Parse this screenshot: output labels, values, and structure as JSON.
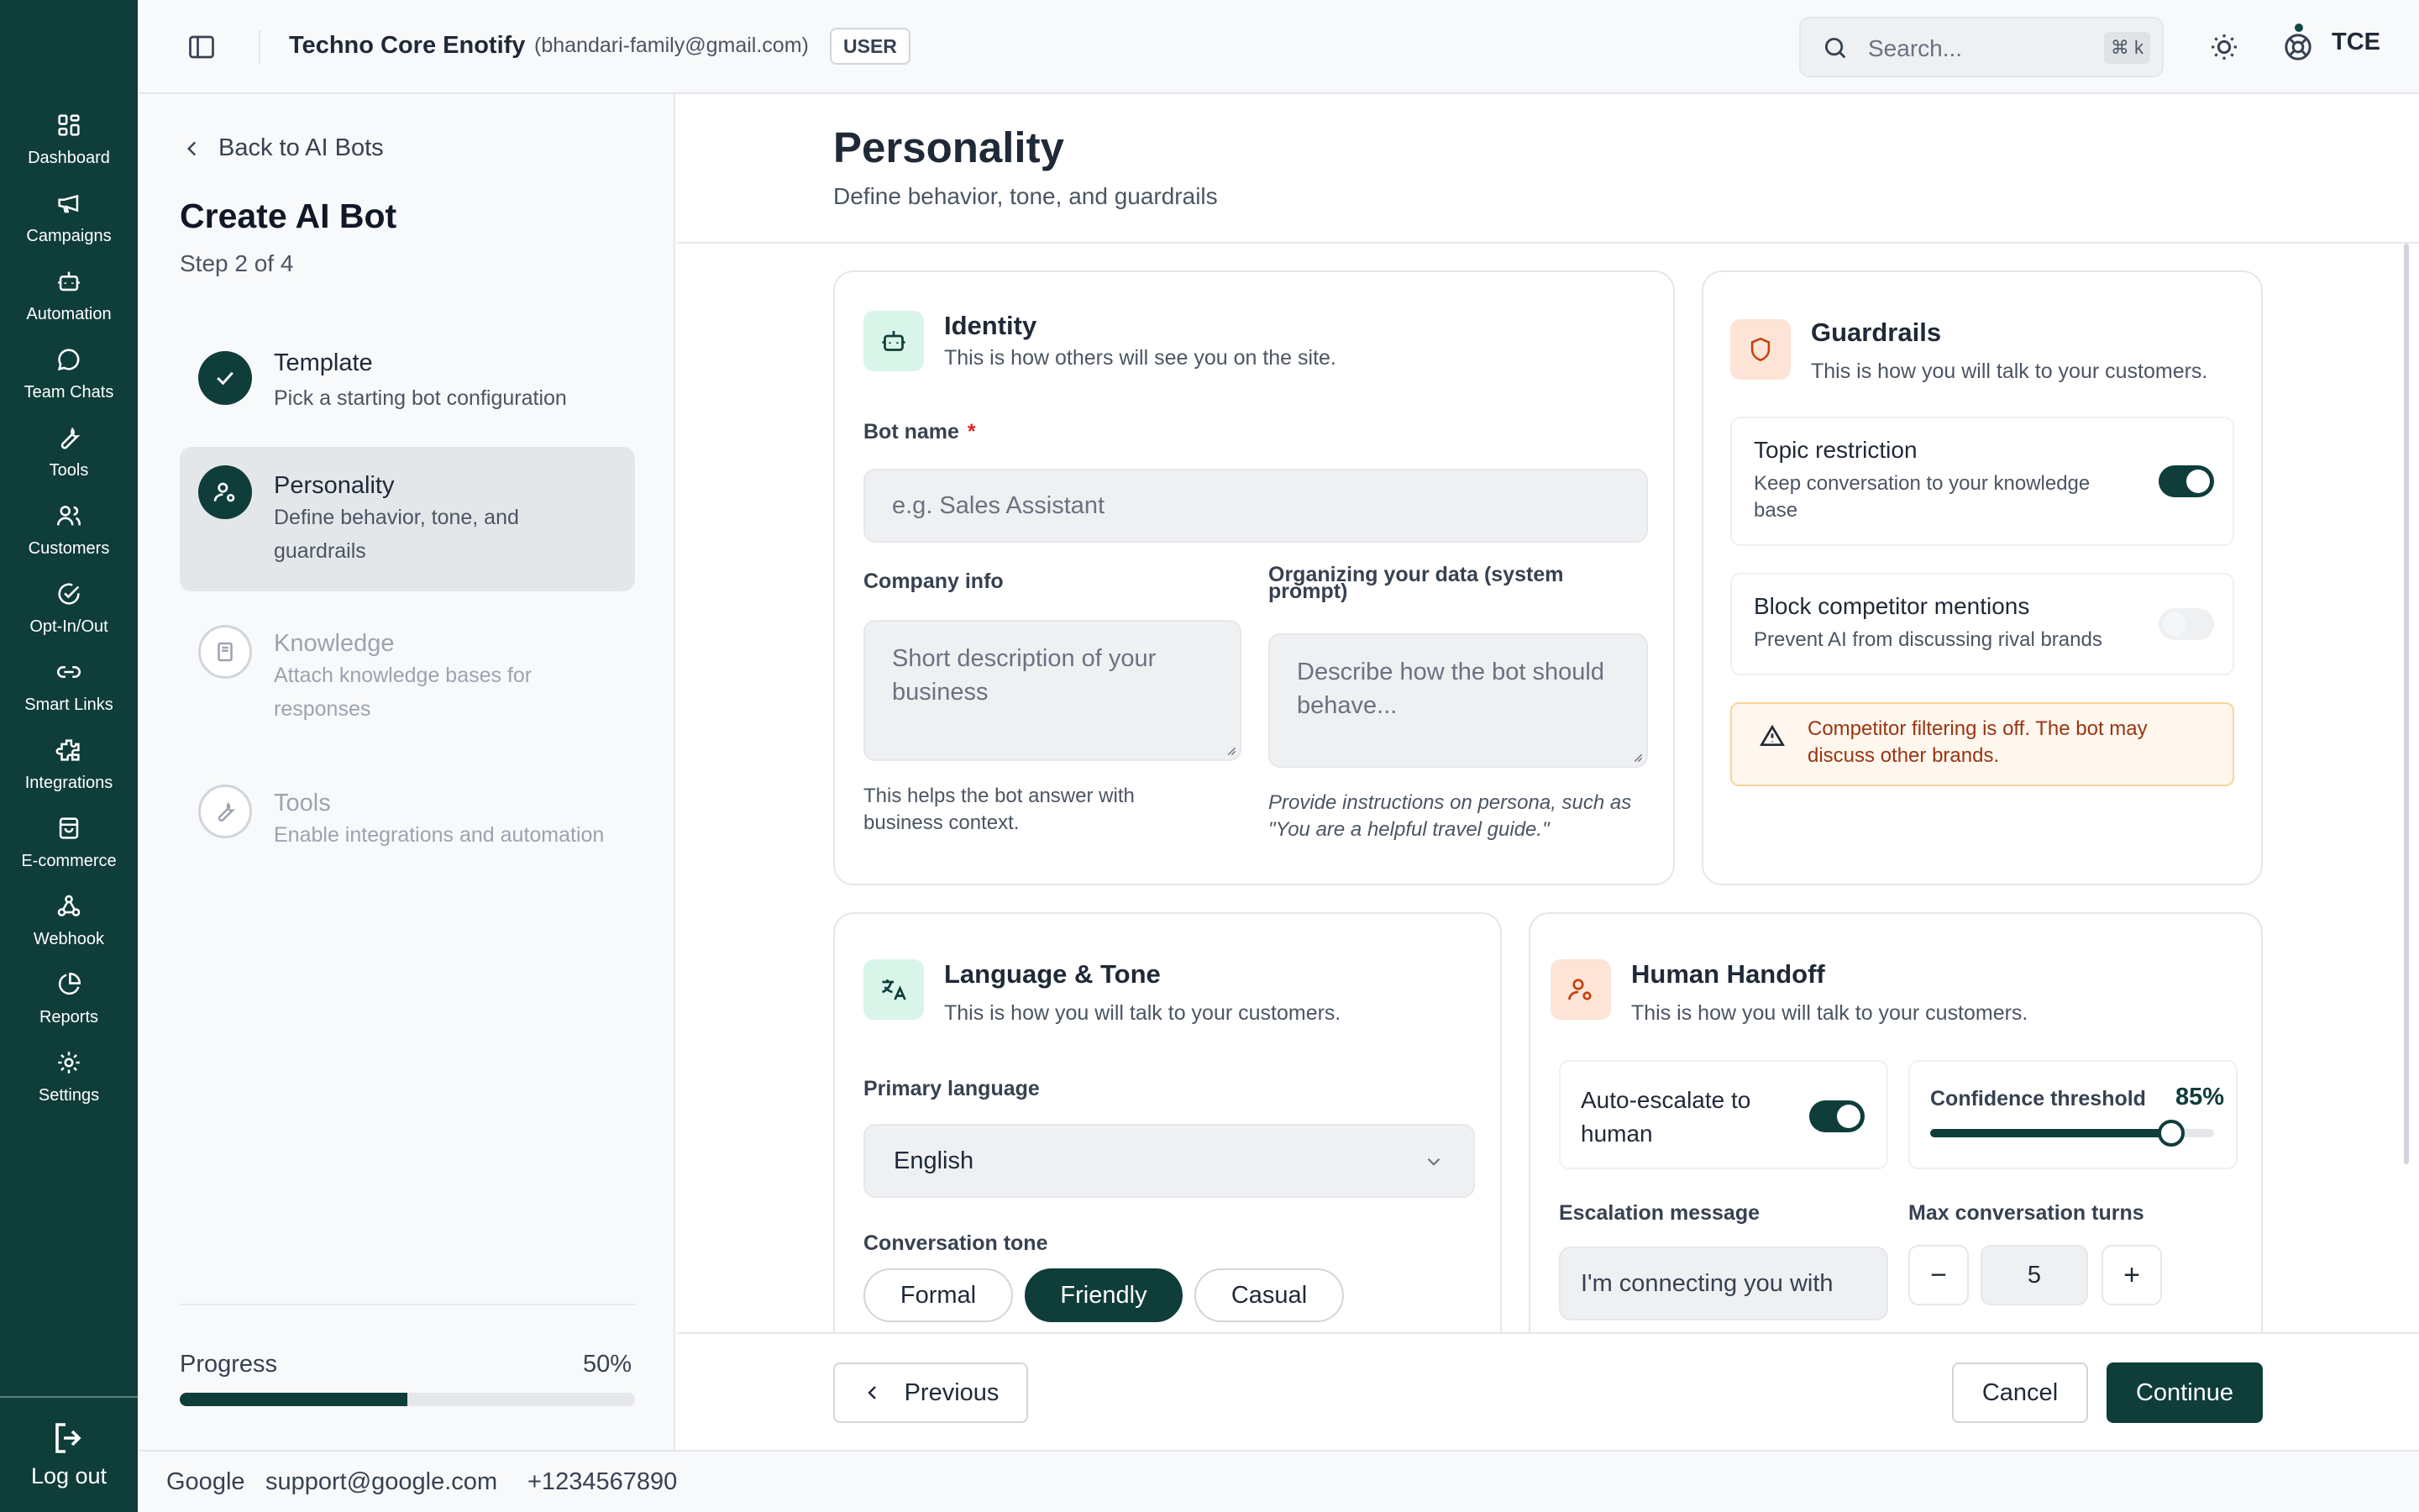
{
  "nav": {
    "items": [
      {
        "label": "Dashboard",
        "icon": "dashboard-icon"
      },
      {
        "label": "Campaigns",
        "icon": "megaphone-icon"
      },
      {
        "label": "Automation",
        "icon": "bot-icon"
      },
      {
        "label": "Team Chats",
        "icon": "chat-icon"
      },
      {
        "label": "Tools",
        "icon": "wrench-icon"
      },
      {
        "label": "Customers",
        "icon": "users-icon"
      },
      {
        "label": "Opt-In/Out",
        "icon": "check-circle-icon"
      },
      {
        "label": "Smart Links",
        "icon": "link-icon"
      },
      {
        "label": "Integrations",
        "icon": "puzzle-icon"
      },
      {
        "label": "E-commerce",
        "icon": "shopping-bag-icon"
      },
      {
        "label": "Webhook",
        "icon": "webhook-icon"
      },
      {
        "label": "Reports",
        "icon": "pie-chart-icon"
      },
      {
        "label": "Settings",
        "icon": "gear-icon"
      }
    ],
    "logout_label": "Log out"
  },
  "header": {
    "org_name": "Techno Core Enotify",
    "org_email": "(bhandari-family@gmail.com)",
    "role": "USER",
    "search_placeholder": "Search...",
    "search_shortcut": "⌘ k",
    "avatar_initials": "TCE"
  },
  "wizard": {
    "back_label": "Back to AI Bots",
    "title": "Create AI Bot",
    "step_indicator": "Step 2 of 4",
    "steps": [
      {
        "title": "Template",
        "desc": "Pick a starting bot configuration",
        "state": "complete"
      },
      {
        "title": "Personality",
        "desc": "Define behavior, tone, and guardrails",
        "state": "active"
      },
      {
        "title": "Knowledge",
        "desc": "Attach knowledge bases for responses",
        "state": "upcoming"
      },
      {
        "title": "Tools",
        "desc": "Enable integrations and automation",
        "state": "upcoming"
      }
    ],
    "progress_label": "Progress",
    "progress_text": "50%",
    "progress_fraction": 0.5
  },
  "page": {
    "title": "Personality",
    "subtitle": "Define behavior, tone, and guardrails"
  },
  "identity": {
    "title": "Identity",
    "subtitle": "This is how others will see you on the site.",
    "bot_name_label": "Bot name",
    "bot_name_required": "*",
    "bot_name_placeholder": "e.g. Sales Assistant",
    "company_label": "Company info",
    "company_placeholder": "Short description of your business",
    "company_help": "This helps the bot answer with business context.",
    "prompt_label": "Organizing your data (system prompt)",
    "prompt_placeholder": "Describe how the bot should behave...",
    "prompt_help": "Provide instructions on persona, such as \"You are a helpful travel guide.\""
  },
  "guardrails": {
    "title": "Guardrails",
    "subtitle": "This is how you will talk to your customers.",
    "topic_title": "Topic restriction",
    "topic_desc": "Keep conversation to your knowledge base",
    "topic_on": true,
    "competitor_title": "Block competitor mentions",
    "competitor_desc": "Prevent AI from discussing rival brands",
    "competitor_on": false,
    "warning": "Competitor filtering is off. The bot may discuss other brands."
  },
  "language": {
    "title": "Language & Tone",
    "subtitle": "This is how you will talk to your customers.",
    "primary_label": "Primary language",
    "primary_value": "English",
    "tone_label": "Conversation tone",
    "tones": [
      "Formal",
      "Friendly",
      "Casual"
    ],
    "selected_tone": "Friendly"
  },
  "handoff": {
    "title": "Human Handoff",
    "subtitle": "This is how you will talk to your customers.",
    "escalate_label": "Auto-escalate to human",
    "escalate_on": true,
    "confidence_label": "Confidence threshold",
    "confidence_text": "85%",
    "confidence_fraction": 0.85,
    "message_label": "Escalation message",
    "message_value": "I'm connecting you with",
    "turns_label": "Max conversation turns",
    "turns_value": "5",
    "minus": "−",
    "plus": "+"
  },
  "actions": {
    "previous": "Previous",
    "cancel": "Cancel",
    "continue": "Continue"
  },
  "footer": {
    "company": "Google",
    "email": "support@google.com",
    "phone": "+1234567890"
  },
  "colors": {
    "brand": "#0f3d3a",
    "warning_text": "#9a3412",
    "required": "#dc2626"
  }
}
